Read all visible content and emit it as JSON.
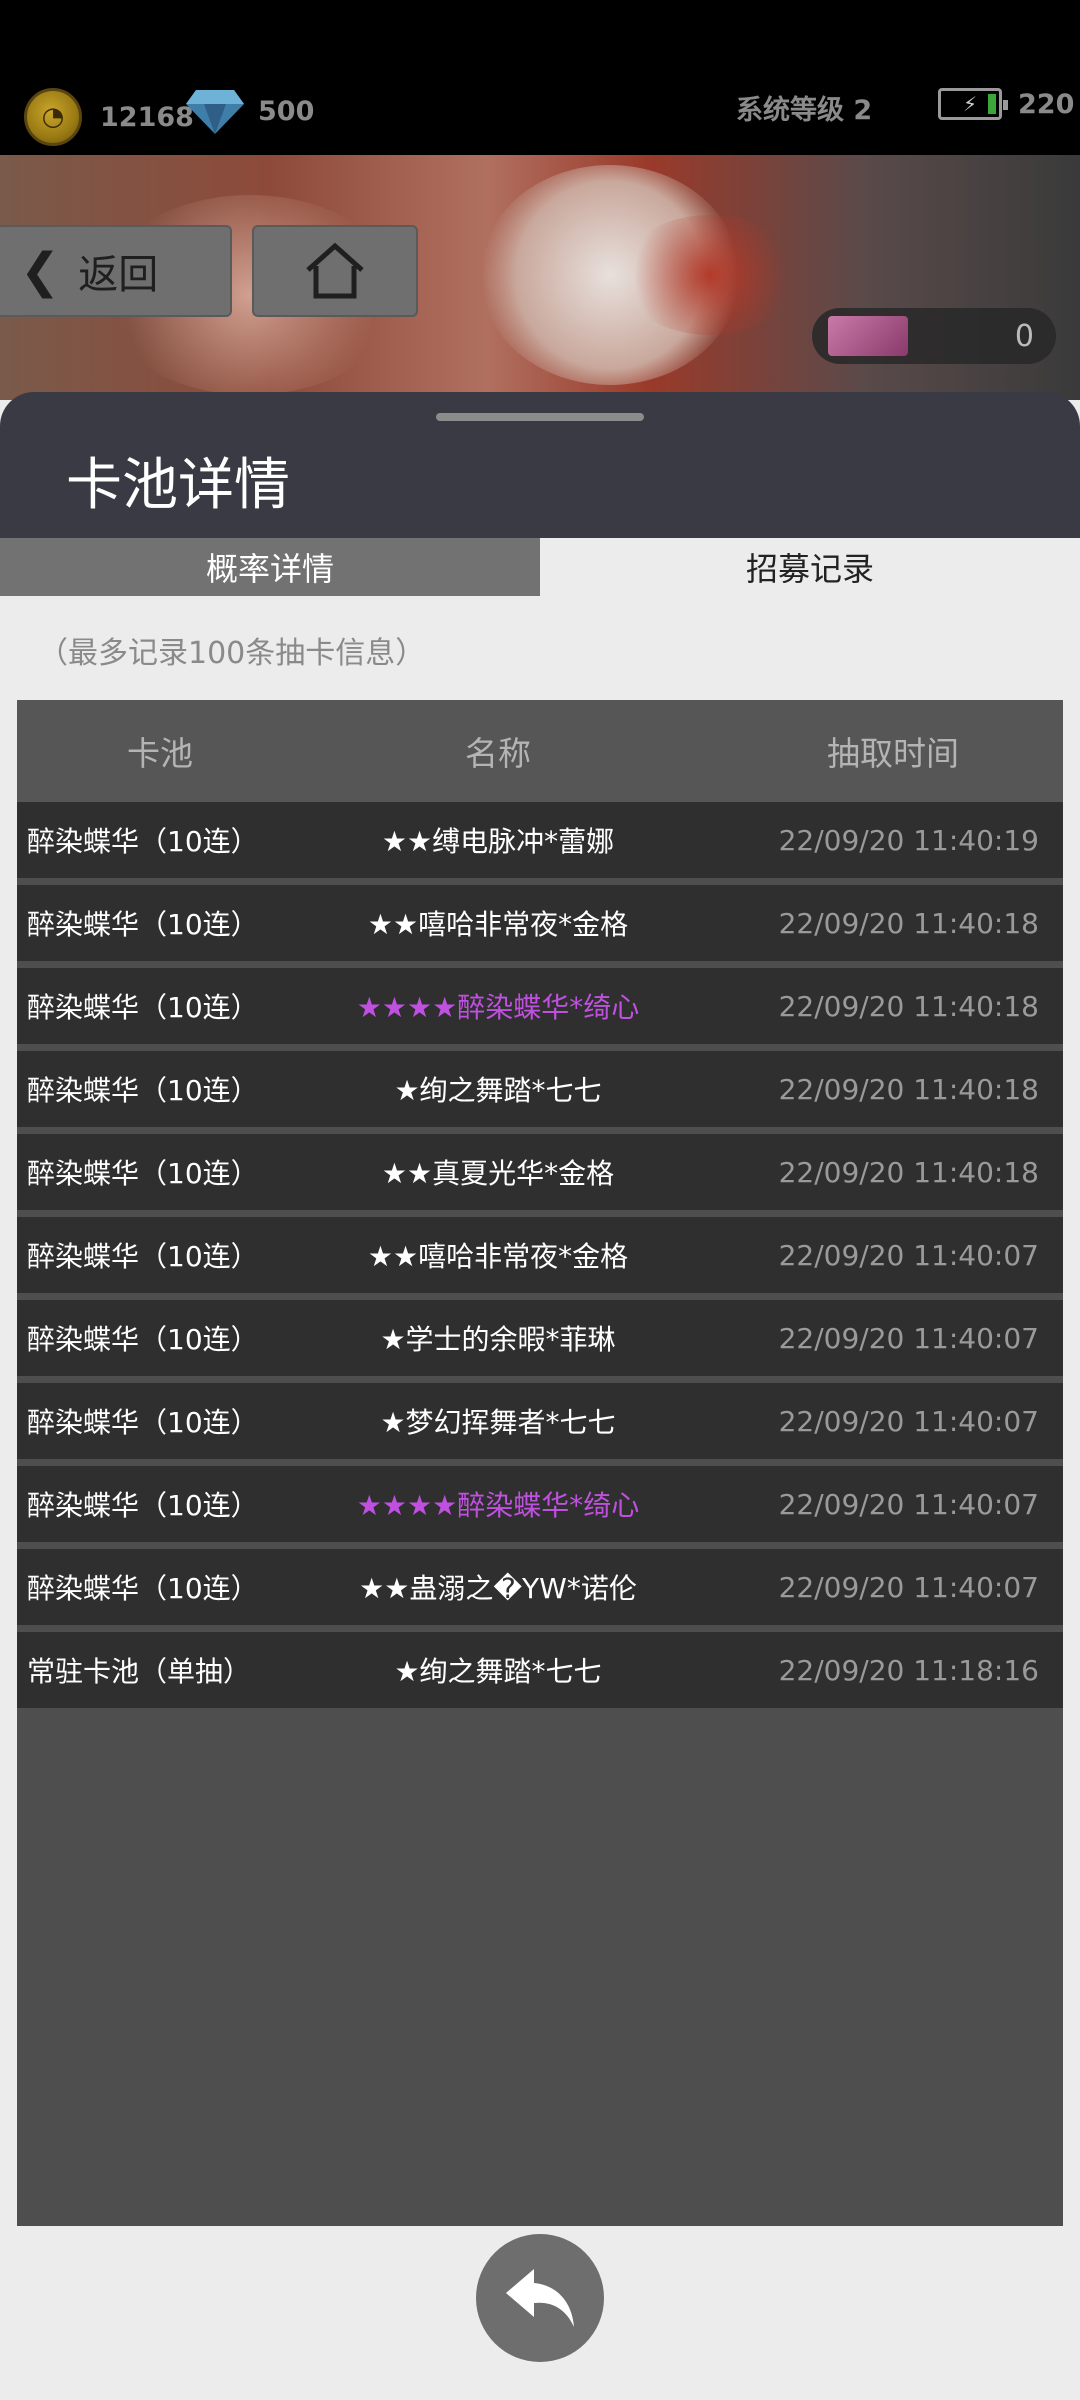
{
  "resources": {
    "coins": "12168",
    "gems": "500",
    "system_level": "系统等级 2",
    "energy": "220",
    "tickets": "0"
  },
  "nav": {
    "back_label": "返回"
  },
  "panel": {
    "title": "卡池详情",
    "tabs": [
      {
        "label": "概率详情",
        "active": false
      },
      {
        "label": "招募记录",
        "active": true
      }
    ],
    "note": "（最多记录100条抽卡信息）"
  },
  "table": {
    "headers": [
      "卡池",
      "名称",
      "抽取时间"
    ],
    "rows": [
      {
        "pool": "醉染蝶华（10连）",
        "name": "★★缚电脉冲*蕾娜",
        "time": "22/09/20 11:40:19",
        "rare": false
      },
      {
        "pool": "醉染蝶华（10连）",
        "name": "★★嘻哈非常夜*金格",
        "time": "22/09/20 11:40:18",
        "rare": false
      },
      {
        "pool": "醉染蝶华（10连）",
        "name": "★★★★醉染蝶华*绮心",
        "time": "22/09/20 11:40:18",
        "rare": true
      },
      {
        "pool": "醉染蝶华（10连）",
        "name": "★绚之舞踏*七七",
        "time": "22/09/20 11:40:18",
        "rare": false
      },
      {
        "pool": "醉染蝶华（10连）",
        "name": "★★真夏光华*金格",
        "time": "22/09/20 11:40:18",
        "rare": false
      },
      {
        "pool": "醉染蝶华（10连）",
        "name": "★★嘻哈非常夜*金格",
        "time": "22/09/20 11:40:07",
        "rare": false
      },
      {
        "pool": "醉染蝶华（10连）",
        "name": "★学士的余暇*菲琳",
        "time": "22/09/20 11:40:07",
        "rare": false
      },
      {
        "pool": "醉染蝶华（10连）",
        "name": "★梦幻挥舞者*七七",
        "time": "22/09/20 11:40:07",
        "rare": false
      },
      {
        "pool": "醉染蝶华（10连）",
        "name": "★★★★醉染蝶华*绮心",
        "time": "22/09/20 11:40:07",
        "rare": true
      },
      {
        "pool": "醉染蝶华（10连）",
        "name": "★★蛊溺之�YW*诺伦",
        "time": "22/09/20 11:40:07",
        "rare": false
      },
      {
        "pool": "常驻卡池（单抽）",
        "name": "★绚之舞踏*七七",
        "time": "22/09/20 11:18:16",
        "rare": false
      }
    ]
  },
  "colors": {
    "rare_text": "#c050e0",
    "panel_header": "#3a3a44"
  },
  "icons": [
    "coin-icon",
    "gem-icon",
    "battery-icon",
    "chevron-left-icon",
    "home-icon",
    "ticket-icon",
    "return-arrow-icon"
  ]
}
